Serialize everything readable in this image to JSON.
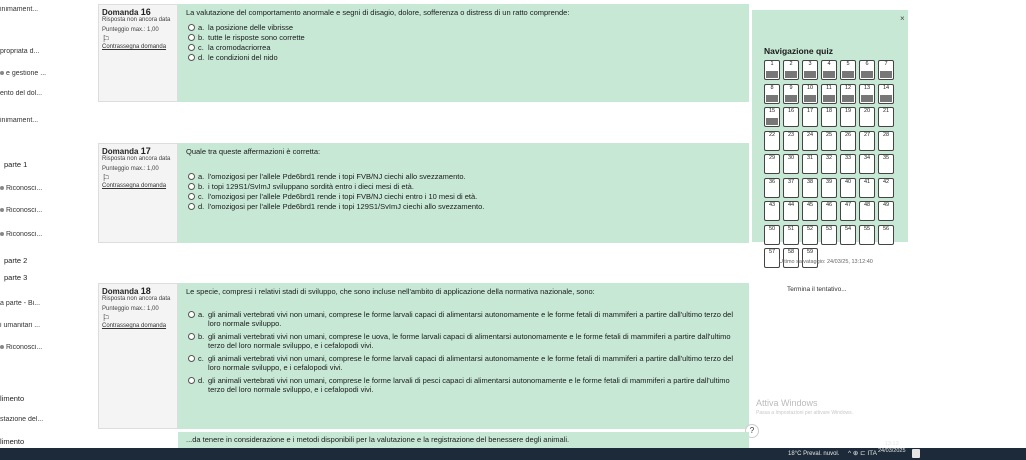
{
  "sidebar": {
    "items": [
      {
        "label": "inimament..."
      },
      {
        "label": "propriata d..."
      },
      {
        "label": "e gestione ..."
      },
      {
        "label": "ento del dol..."
      },
      {
        "label": "inimament..."
      },
      {
        "label": "parte 1"
      },
      {
        "label": "Riconosci..."
      },
      {
        "label": "Riconosci..."
      },
      {
        "label": "Riconosci..."
      },
      {
        "label": "parte 2"
      },
      {
        "label": "parte 3"
      },
      {
        "label": "a parte - Bi..."
      },
      {
        "label": "i umanitari ..."
      },
      {
        "label": "Riconosci..."
      },
      {
        "label": "limento"
      },
      {
        "label": "stazione del..."
      },
      {
        "label": "limento"
      }
    ]
  },
  "questions": [
    {
      "label": "Domanda",
      "number": "16",
      "status": "Risposta non ancora data",
      "score": "Punteggio max.: 1,00",
      "flag_label": "Contrassegna domanda",
      "text": "La valutazione del comportamento anormale e segni di disagio, dolore, sofferenza o distress di un ratto comprende:",
      "options": [
        {
          "letter": "a.",
          "text": "la posizione delle vibrisse"
        },
        {
          "letter": "b.",
          "text": "tutte le risposte sono corrette"
        },
        {
          "letter": "c.",
          "text": "la cromodacriorrea"
        },
        {
          "letter": "d.",
          "text": "le condizioni del nido"
        }
      ]
    },
    {
      "label": "Domanda",
      "number": "17",
      "status": "Risposta non ancora data",
      "score": "Punteggio max.: 1,00",
      "flag_label": "Contrassegna domanda",
      "text": "Quale tra queste affermazioni è corretta:",
      "options": [
        {
          "letter": "a.",
          "text": "l'omozigosi per l'allele Pde6brd1 rende i topi FVB/NJ ciechi allo svezzamento."
        },
        {
          "letter": "b.",
          "text": "i topi 129S1/SvImJ sviluppano sordità entro i dieci mesi di età."
        },
        {
          "letter": "c.",
          "text": "l'omozigosi per l'allele Pde6brd1 rende i topi FVB/NJ ciechi entro i 10 mesi di età."
        },
        {
          "letter": "d.",
          "text": "l'omozigosi per l'allele Pde6brd1 rende i topi 129S1/SvImJ ciechi allo svezzamento."
        }
      ]
    },
    {
      "label": "Domanda",
      "number": "18",
      "status": "Risposta non ancora data",
      "score": "Punteggio max.: 1,00",
      "flag_label": "Contrassegna domanda",
      "text": "Le specie, compresi i relativi stadi di sviluppo, che sono incluse nell'ambito di applicazione della normativa nazionale, sono:",
      "options": [
        {
          "letter": "a.",
          "text": "gli animali vertebrati vivi non umani, comprese le forme larvali capaci di alimentarsi autonomamente e le forme fetali di mammiferi a partire dall'ultimo terzo del loro normale sviluppo."
        },
        {
          "letter": "b.",
          "text": "gli animali vertebrati vivi non umani, comprese le uova, le forme larvali capaci di alimentarsi autonomamente e le forme fetali di mammiferi a partire dall'ultimo terzo del loro normale sviluppo, e i cefalopodi vivi."
        },
        {
          "letter": "c.",
          "text": "gli animali vertebrati vivi non umani, comprese le forme larvali capaci di alimentarsi autonomamente e le forme fetali di mammiferi a partire dall'ultimo terzo del loro normale sviluppo, e i cefalopodi vivi."
        },
        {
          "letter": "d.",
          "text": "gli animali vertebrati vivi non umani, comprese le forme larvali di pesci capaci di alimentarsi autonomamente e le forme fetali di mammiferi a partire dall'ultimo terzo del loro normale sviluppo, e i cefalopodi vivi."
        }
      ]
    }
  ],
  "nav": {
    "title": "Navigazione quiz",
    "close": "×",
    "buttons": [
      "1",
      "2",
      "3",
      "4",
      "5",
      "6",
      "7",
      "8",
      "9",
      "10",
      "11",
      "12",
      "13",
      "14",
      "15",
      "16",
      "17",
      "18",
      "19",
      "20",
      "21",
      "22",
      "23",
      "24",
      "25",
      "26",
      "27",
      "28",
      "29",
      "30",
      "31",
      "32",
      "33",
      "34",
      "35",
      "36",
      "37",
      "38",
      "39",
      "40",
      "41",
      "42",
      "43",
      "44",
      "45",
      "46",
      "47",
      "48",
      "49",
      "50",
      "51",
      "52",
      "53",
      "54",
      "55",
      "56",
      "57",
      "58",
      "59"
    ],
    "answered_count": 15
  },
  "saved": "Ultimo salvataggio: 24/03/25, 13:12:40",
  "finish": "Termina il tentativo...",
  "watermark": {
    "title": "Attiva Windows",
    "subtitle": "Passa a Impostazioni per attivare Windows."
  },
  "help": "?",
  "bottom_question": "...da tenere in considerazione e i metodi disponibili per la valutazione e la registrazione del benessere degli animali.",
  "taskbar": {
    "weather": "18°C Preval. nuvol.",
    "icons": "^ ⊕ ⊏ ITA",
    "time": "13:13",
    "date": "24/03/2025"
  }
}
